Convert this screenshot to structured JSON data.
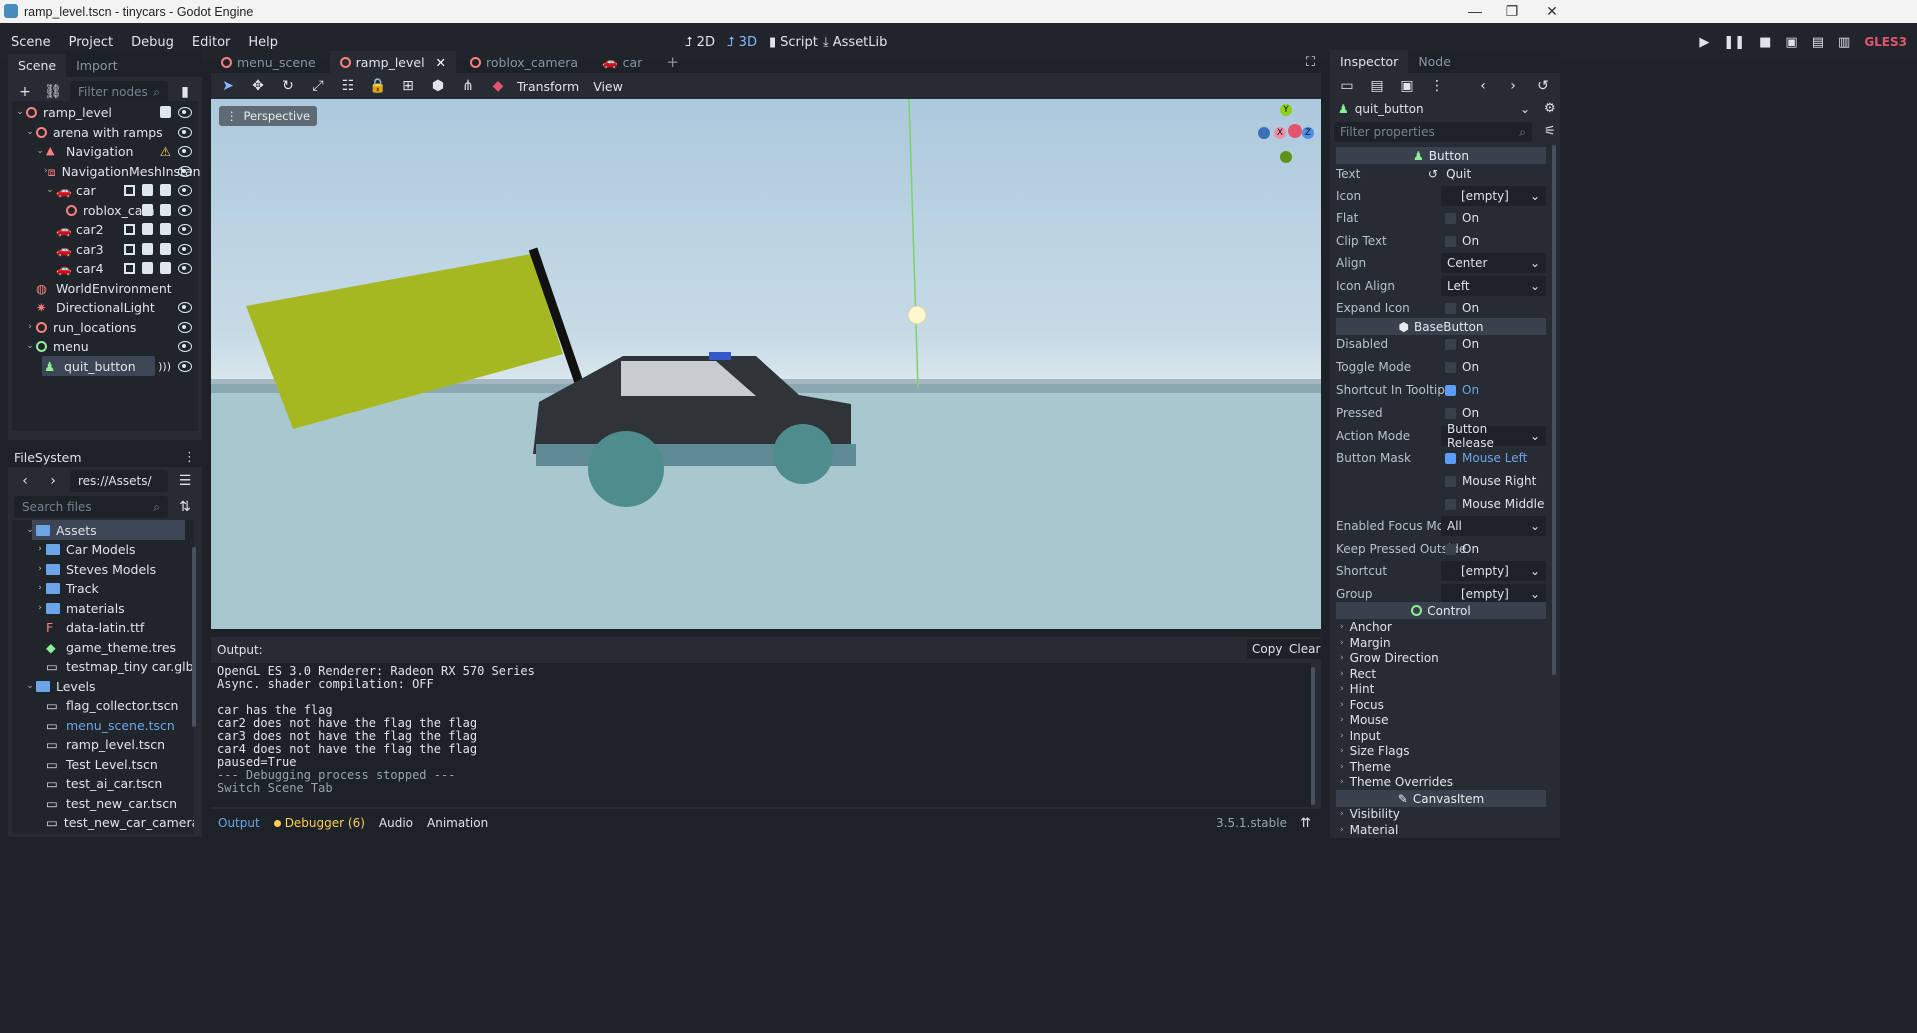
{
  "window": {
    "title": "ramp_level.tscn - tinycars - Godot Engine"
  },
  "menu": [
    "Scene",
    "Project",
    "Debug",
    "Editor",
    "Help"
  ],
  "workspaces": {
    "2d": "2D",
    "3d": "3D",
    "script": "Script",
    "assetlib": "AssetLib"
  },
  "renderer": "GLES3",
  "scene_panel": {
    "tabs": [
      "Scene",
      "Import"
    ],
    "filter_placeholder": "Filter nodes",
    "nodes": [
      {
        "label": "ramp_level",
        "color": "#fc7f7f"
      },
      {
        "label": "arena with ramps",
        "color": "#fc7f7f"
      },
      {
        "label": "Navigation",
        "color": "#fc7f7f"
      },
      {
        "label": "NavigationMeshInstan",
        "color": "#fc7f7f"
      },
      {
        "label": "car",
        "color": "#fc7f7f"
      },
      {
        "label": "roblox_cam",
        "color": "#fc7f7f"
      },
      {
        "label": "car2",
        "color": "#fc7f7f"
      },
      {
        "label": "car3",
        "color": "#fc7f7f"
      },
      {
        "label": "car4",
        "color": "#fc7f7f"
      },
      {
        "label": "WorldEnvironment",
        "color": "#fc7f7f"
      },
      {
        "label": "DirectionalLight",
        "color": "#fc7f7f"
      },
      {
        "label": "run_locations",
        "color": "#fc7f7f"
      },
      {
        "label": "menu",
        "color": "#8eef97"
      },
      {
        "label": "quit_button",
        "color": "#8eef97"
      }
    ]
  },
  "filesystem": {
    "title": "FileSystem",
    "path": "res://Assets/",
    "search_placeholder": "Search files",
    "items": [
      "Assets",
      "Car Models",
      "Steves Models",
      "Track",
      "materials",
      "data-latin.ttf",
      "game_theme.tres",
      "testmap_tiny car.glb",
      "Levels",
      "flag_collector.tscn",
      "menu_scene.tscn",
      "ramp_level.tscn",
      "Test Level.tscn",
      "test_ai_car.tscn",
      "test_new_car.tscn",
      "test_new_car_camera.tscn"
    ]
  },
  "editor_tabs": [
    "menu_scene",
    "ramp_level",
    "roblox_camera",
    "car"
  ],
  "viewport_toolbar": {
    "transform": "Transform",
    "view": "View",
    "perspective": "Perspective"
  },
  "gizmo": {
    "y": "Y",
    "x": "X",
    "z": "Z"
  },
  "output": {
    "label": "Output:",
    "copy": "Copy",
    "clear": "Clear",
    "lines": [
      "OpenGL ES 3.0 Renderer: Radeon RX 570 Series",
      "Async. shader compilation: OFF",
      "",
      "car has the flag",
      "car2 does not have the flag the flag",
      "car3 does not have the flag the flag",
      "car4 does not have the flag the flag",
      "paused=True",
      "--- Debugging process stopped ---",
      "Switch Scene Tab"
    ]
  },
  "bottom_tabs": {
    "output": "Output",
    "debugger": "Debugger (6)",
    "audio": "Audio",
    "animation": "Animation",
    "version": "3.5.1.stable"
  },
  "inspector": {
    "tabs": [
      "Inspector",
      "Node"
    ],
    "object": "quit_button",
    "filter_placeholder": "Filter properties",
    "sections": {
      "button": "Button",
      "basebutton": "BaseButton",
      "control": "Control",
      "canvasitem": "CanvasItem"
    },
    "props": [
      {
        "name": "Text",
        "value": "Quit"
      },
      {
        "name": "Icon",
        "value": "[empty]"
      },
      {
        "name": "Flat",
        "value": "On",
        "checked": false
      },
      {
        "name": "Clip Text",
        "value": "On",
        "checked": false
      },
      {
        "name": "Align",
        "value": "Center"
      },
      {
        "name": "Icon Align",
        "value": "Left"
      },
      {
        "name": "Expand Icon",
        "value": "On",
        "checked": false
      },
      {
        "name": "Disabled",
        "value": "On",
        "checked": false
      },
      {
        "name": "Toggle Mode",
        "value": "On",
        "checked": false
      },
      {
        "name": "Shortcut In Tooltip",
        "value": "On",
        "checked": true
      },
      {
        "name": "Pressed",
        "value": "On",
        "checked": false
      },
      {
        "name": "Action Mode",
        "value": "Button Release"
      },
      {
        "name": "Button Mask",
        "value": "Mouse Left",
        "checked": true
      },
      {
        "name": "",
        "value": "Mouse Right",
        "checked": false
      },
      {
        "name": "",
        "value": "Mouse Middle",
        "checked": false
      },
      {
        "name": "Enabled Focus Mode",
        "value": "All"
      },
      {
        "name": "Keep Pressed Outside",
        "value": "On",
        "checked": false
      },
      {
        "name": "Shortcut",
        "value": "[empty]"
      },
      {
        "name": "Group",
        "value": "[empty]"
      }
    ],
    "control_groups": [
      "Anchor",
      "Margin",
      "Grow Direction",
      "Rect",
      "Hint",
      "Focus",
      "Mouse",
      "Input",
      "Size Flags",
      "Theme",
      "Theme Overrides"
    ],
    "canvas_groups": [
      "Visibility",
      "Material"
    ]
  }
}
